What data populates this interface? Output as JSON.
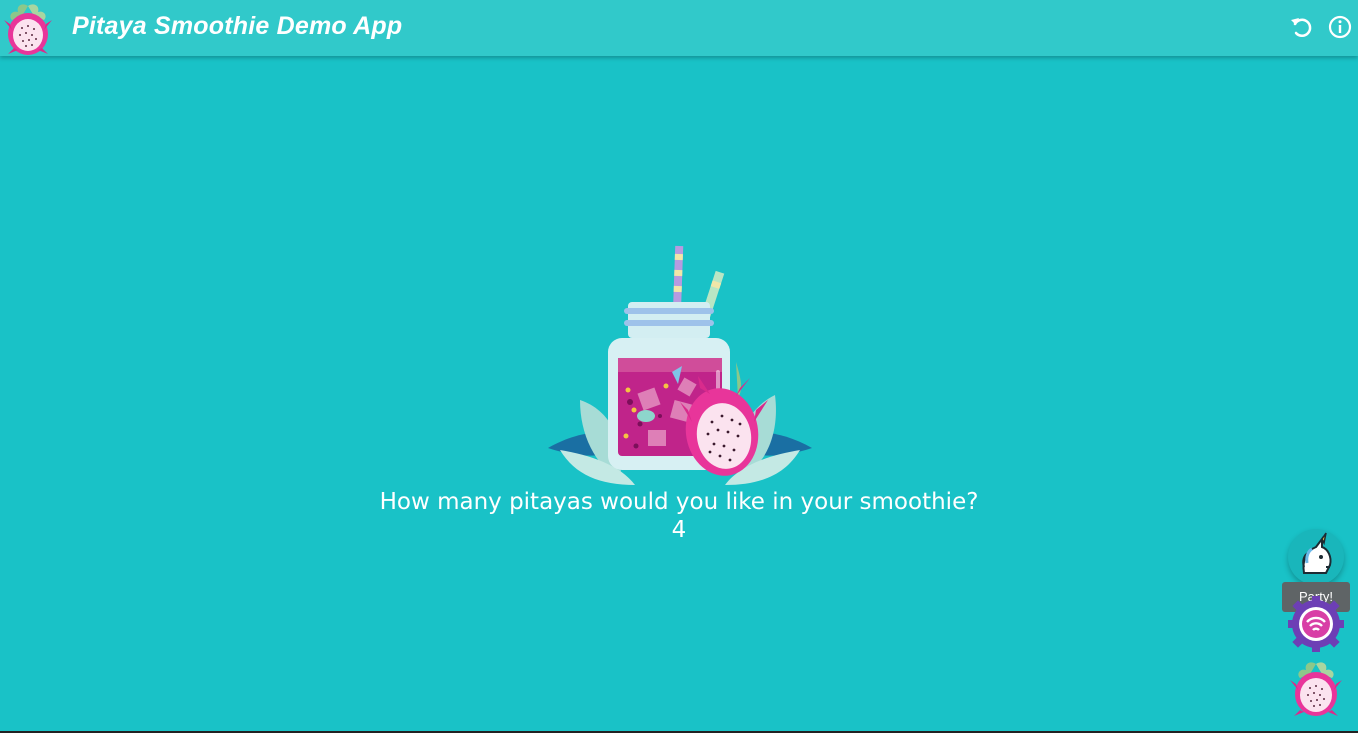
{
  "app": {
    "title": "Pitaya Smoothie Demo App"
  },
  "header": {
    "reset_icon": "reset-icon",
    "info_icon": "info-icon"
  },
  "main": {
    "question": "How many pitayas would you like in your smoothie?",
    "answer": "4"
  },
  "fabs": {
    "unicorn_icon": "unicorn-icon",
    "tooltip": "Party!",
    "gear_icon": "gear-icon",
    "pitaya_icon": "pitaya-icon"
  },
  "colors": {
    "background": "#19c2c7",
    "header": "#31c9ca",
    "pitaya_pink": "#e8359a",
    "smoothie": "#c0248a"
  }
}
